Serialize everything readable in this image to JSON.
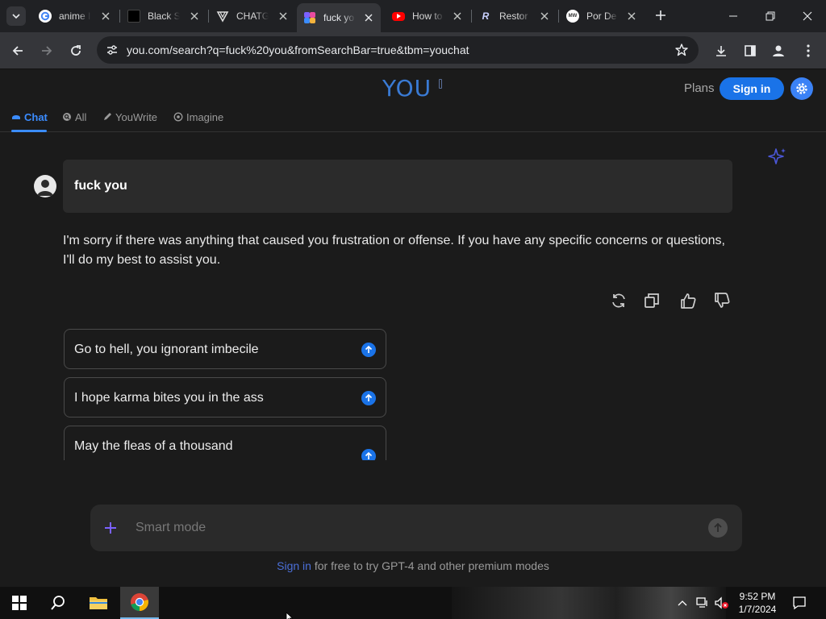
{
  "browser": {
    "tabs": [
      {
        "title": "anime I",
        "favicon": "google-icon"
      },
      {
        "title": "Black S",
        "favicon": "black-square-icon"
      },
      {
        "title": "CHATG",
        "favicon": "chatgpt-icon"
      },
      {
        "title": "fuck yo",
        "favicon": "you-icon",
        "active": true
      },
      {
        "title": "How to",
        "favicon": "youtube-icon"
      },
      {
        "title": "Restor",
        "favicon": "r-icon"
      },
      {
        "title": "Por De",
        "favicon": "mw-icon"
      }
    ],
    "url": "you.com/search?q=fuck%20you&fromSearchBar=true&tbm=youchat"
  },
  "header": {
    "logo": "YOU",
    "plans_label": "Plans",
    "signin_label": "Sign in"
  },
  "nav_tabs": [
    {
      "label": "Chat",
      "icon": "chat-icon",
      "active": true
    },
    {
      "label": "All",
      "icon": "search-icon"
    },
    {
      "label": "YouWrite",
      "icon": "pen-icon"
    },
    {
      "label": "Imagine",
      "icon": "imagine-icon"
    }
  ],
  "chat": {
    "user_message": "fuck you",
    "reply": "I'm sorry if there was anything that caused you frustration or offense. If you have any specific concerns or questions, I'll do my best to assist you.",
    "actions": [
      "regenerate-icon",
      "copy-icon",
      "thumbs-up-icon",
      "thumbs-down-icon"
    ],
    "suggestions": [
      "Go to hell, you ignorant imbecile",
      "I hope karma bites you in the ass",
      "May the fleas of a thousand"
    ]
  },
  "input": {
    "placeholder": "Smart mode"
  },
  "footer": {
    "signin_link": "Sign in",
    "note": " for free to try GPT-4 and other premium modes"
  },
  "taskbar": {
    "time": "9:52 PM",
    "date": "1/7/2024"
  },
  "colors": {
    "accent": "#1a73e8",
    "page_bg": "#1b1b1b",
    "chrome_toolbar": "#35363a"
  }
}
